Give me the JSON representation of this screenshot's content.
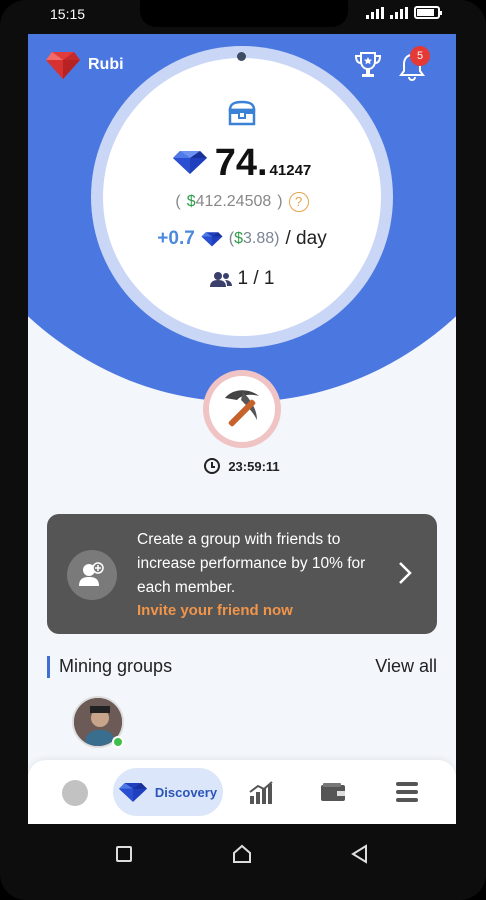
{
  "status_bar": {
    "time": "15:15",
    "battery_level": 0.85
  },
  "header": {
    "app_name": "Rubi",
    "notification_count": "5"
  },
  "balance": {
    "integer": "74.",
    "decimal": "41247",
    "usd_open": "(",
    "usd_symbol": "$",
    "usd_value": "412.24508",
    "usd_close": ")",
    "help": "?"
  },
  "rate": {
    "plus": "+0.7",
    "usd_open": "(",
    "usd_symbol": "$",
    "usd_value": "3.88)",
    "per_day": "/ day"
  },
  "members": {
    "count": "1 / 1"
  },
  "timer": {
    "value": "23:59:11"
  },
  "invite": {
    "text": "Create a group with friends to increase performance by 10% for each member.",
    "link": "Invite your friend now"
  },
  "groups": {
    "title": "Mining groups",
    "view_all": "View all"
  },
  "bottom_nav": {
    "discovery_label": "Discovery"
  },
  "colors": {
    "primary": "#4b77e0",
    "accent": "#f0954a",
    "green": "#2e9e4a",
    "badge": "#e53935"
  },
  "icons": [
    "ruby-logo-icon",
    "trophy-icon",
    "bell-icon",
    "chest-icon",
    "gem-icon",
    "help-icon",
    "people-icon",
    "pickaxe-icon",
    "clock-icon",
    "add-user-icon",
    "chevron-right-icon",
    "profile-icon",
    "chart-icon",
    "wallet-icon",
    "menu-icon"
  ]
}
